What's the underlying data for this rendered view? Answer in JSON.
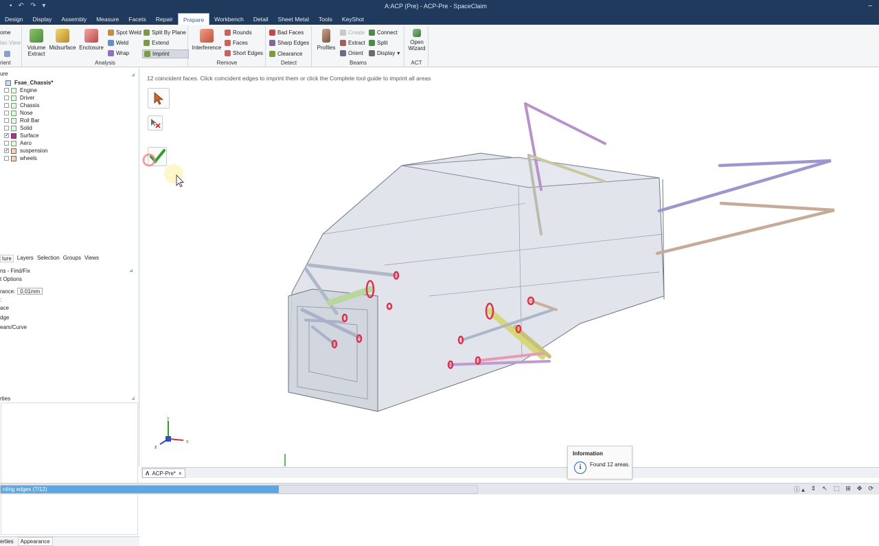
{
  "window": {
    "title": "A:ACP (Pre) - ACP-Pre - SpaceClaim"
  },
  "tabs": [
    "Design",
    "Display",
    "Assembly",
    "Measure",
    "Facets",
    "Repair",
    "Prepare",
    "Workbench",
    "Detail",
    "Sheet Metal",
    "Tools",
    "KeyShot"
  ],
  "active_tab": "Prepare",
  "ribbon": {
    "orient": {
      "home": "ome",
      "plan_view": "lan View",
      "label": "rient"
    },
    "analysis": {
      "volume_extract": [
        "Volume",
        "Extract"
      ],
      "midsurface": "Midsurface",
      "enclosure": "Enclosure",
      "spot_weld": "Spot Weld",
      "weld": "Weld",
      "wrap": "Wrap",
      "split_by_plane": "Split By Plane",
      "extend": "Extend",
      "imprint": "Imprint",
      "label": "Analysis"
    },
    "remove": {
      "interference": "Interference",
      "rounds": "Rounds",
      "faces": "Faces",
      "short_edges": "Short Edges",
      "label": "Remove"
    },
    "detect": {
      "bad_faces": "Bad Faces",
      "sharp_edges": "Sharp Edges",
      "clearance": "Clearance",
      "label": "Detect"
    },
    "beams": {
      "profiles": "Profiles",
      "create": "Create",
      "extract": "Extract",
      "orient": "Orient",
      "connect": "Connect",
      "split": "Split",
      "display": "Display",
      "label": "Beams"
    },
    "act": {
      "open_wizard": [
        "Open",
        "Wizard"
      ],
      "label": "ACT"
    }
  },
  "structure": {
    "header": "ure",
    "root": "Fsae_Chassis*",
    "items": [
      {
        "label": "Engine",
        "checked": false,
        "kind": "body"
      },
      {
        "label": "Driver",
        "checked": false,
        "kind": "body"
      },
      {
        "label": "Chassis",
        "checked": false,
        "kind": "body"
      },
      {
        "label": "Nose",
        "checked": false,
        "kind": "body"
      },
      {
        "label": "Roll Bar",
        "checked": false,
        "kind": "body"
      },
      {
        "label": "Solid",
        "checked": false,
        "kind": "body"
      },
      {
        "label": "Surface",
        "checked": true,
        "kind": "surface"
      },
      {
        "label": "Aero",
        "checked": false,
        "kind": "body"
      },
      {
        "label": "suspension",
        "checked": true,
        "kind": "component"
      },
      {
        "label": "wheels",
        "checked": false,
        "kind": "component"
      }
    ]
  },
  "panel_tabs": [
    "ture",
    "Layers",
    "Selection",
    "Groups",
    "Views"
  ],
  "options": {
    "header": "ns - Find/Fix",
    "subheader": "t Options",
    "tolerance_label": "rance:",
    "tolerance_value": "0.01mm",
    "line_colon": ":",
    "face": "ace",
    "edge": "dge",
    "beam": "eam/Curve"
  },
  "properties": {
    "header": "rties"
  },
  "bottom_tabs": [
    "erties",
    "Appearance"
  ],
  "viewport": {
    "hint": "12 coincident faces. Click coincident edges to imprint them or click the Complete tool guide to imprint all areas",
    "triad": {
      "x": "x",
      "y": "y",
      "z": "z"
    }
  },
  "document_tab": "ACP-Pre*",
  "info": {
    "title": "Information",
    "message": "Found 12 areas."
  },
  "status": {
    "progress_text": "nting edges (7/12)",
    "progress": 0.583
  },
  "colors": {
    "titlebar": "#1f3a5c",
    "accent": "#2c5fa0",
    "progress": "#5aa7e6",
    "complete_check": "#2e9e2e"
  }
}
